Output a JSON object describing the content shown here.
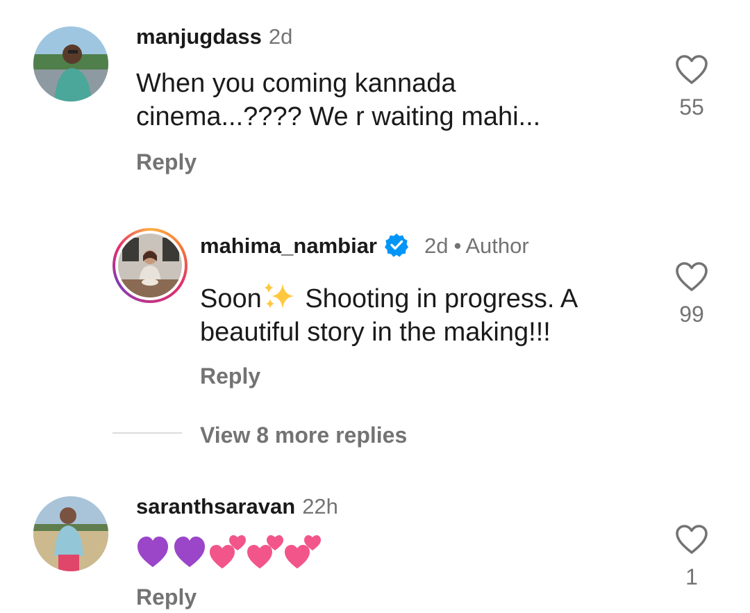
{
  "comments": [
    {
      "username": "manjugdass",
      "time": "2d",
      "text_lines": [
        "When you coming kannada",
        "cinema...???? We r waiting mahi..."
      ],
      "reply_label": "Reply",
      "likes": "55",
      "avatar": "avatar-manjugdass"
    },
    {
      "username": "mahima_nambiar",
      "verified": true,
      "time": "2d",
      "separator": "•",
      "badge": "Author",
      "text_lines": [
        "Soon",
        "Shooting in progress. A",
        "beautiful story in the making!!!"
      ],
      "reply_label": "Reply",
      "likes": "99",
      "avatar": "avatar-mahima_nambiar-story-ring"
    },
    {
      "username": "saranthsaravan",
      "time": "22h",
      "text": "💜💜💕💕💕",
      "reply_label": "Reply",
      "likes": "1",
      "avatar": "avatar-saranthsaravan"
    }
  ],
  "view_more_replies": "View 8 more replies",
  "colors": {
    "text_primary": "#1a1a1a",
    "text_secondary": "#737373",
    "verified_blue": "#0095f6",
    "divider": "#dbdbdb"
  },
  "icons": {
    "like": "heart-outline-icon",
    "verified": "verified-badge-icon",
    "sparkle": "sparkles-emoji"
  }
}
